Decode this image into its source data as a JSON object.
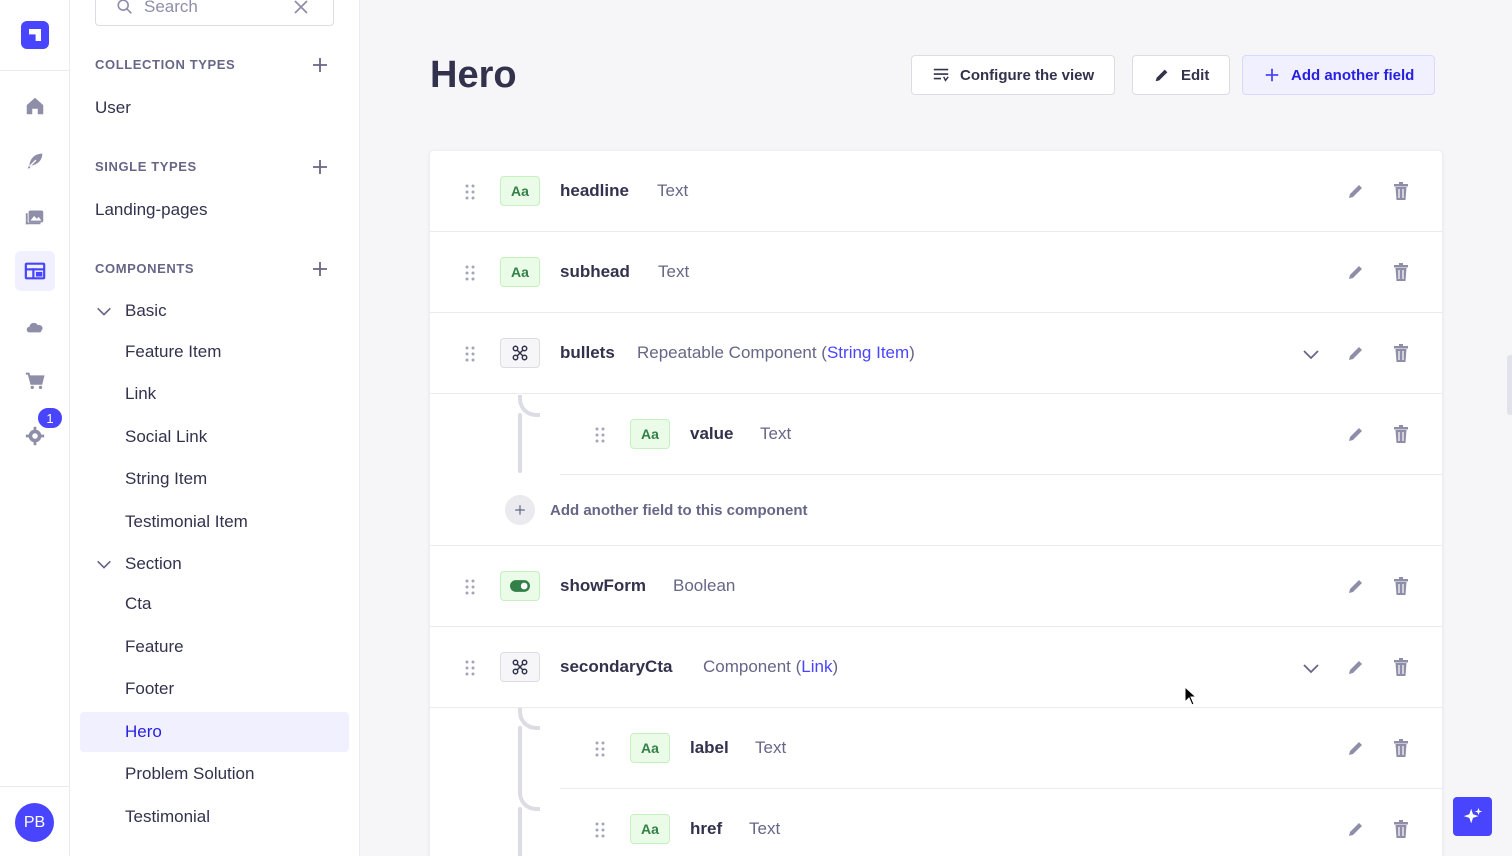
{
  "rail": {
    "items": [
      {
        "name": "home-icon"
      },
      {
        "name": "feather-icon"
      },
      {
        "name": "media-library-icon"
      },
      {
        "name": "content-type-builder-icon"
      },
      {
        "name": "cloud-icon"
      },
      {
        "name": "cart-icon"
      },
      {
        "name": "gear-icon"
      }
    ],
    "badge": "1",
    "avatar": "PB",
    "accent": "#4945ff"
  },
  "subnav": {
    "search_placeholder": "Search",
    "collection_types": {
      "title": "COLLECTION TYPES",
      "items": [
        "User"
      ]
    },
    "single_types": {
      "title": "SINGLE TYPES",
      "items": [
        "Landing-pages"
      ]
    },
    "components": {
      "title": "COMPONENTS",
      "groups": [
        {
          "label": "Basic",
          "items": [
            "Feature Item",
            "Link",
            "Social Link",
            "String Item",
            "Testimonial Item"
          ]
        },
        {
          "label": "Section",
          "items": [
            "Cta",
            "Feature",
            "Footer",
            "Hero",
            "Problem Solution",
            "Testimonial"
          ]
        }
      ],
      "active": "Hero"
    }
  },
  "main": {
    "title": "Hero",
    "buttons": {
      "configure": "Configure the view",
      "edit": "Edit",
      "add_field": "Add another field"
    },
    "fields": [
      {
        "name": "headline",
        "type": "Text",
        "icon": "Aa"
      },
      {
        "name": "subhead",
        "type": "Text",
        "icon": "Aa"
      },
      {
        "name": "bullets",
        "type_prefix": "Repeatable Component (",
        "type_link": "String Item",
        "type_suffix": ")"
      },
      {
        "name": "value",
        "type": "Text",
        "icon": "Aa"
      },
      {
        "name": "showForm",
        "type": "Boolean"
      },
      {
        "name": "secondaryCta",
        "type_prefix": "Component (",
        "type_link": "Link",
        "type_suffix": ")"
      },
      {
        "name": "label",
        "type": "Text",
        "icon": "Aa"
      },
      {
        "name": "href",
        "type": "Text",
        "icon": "Aa"
      }
    ],
    "add_sub_field": "Add another field to this component"
  }
}
